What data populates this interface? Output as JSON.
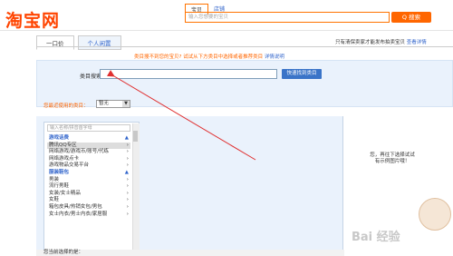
{
  "header": {
    "logo": "淘宝网",
    "search_tabs": [
      "宝贝",
      "店铺"
    ],
    "search_placeholder": "输入您想要的宝贝",
    "search_button": "Q 搜索"
  },
  "tabs": [
    "一口价",
    "个人闲置"
  ],
  "topright": {
    "text": "只有清保卖家才能发布拍卖宝贝",
    "link": "查看详情"
  },
  "notice": {
    "text": "类目搜不到您的宝贝? 试试从下方类目中选择或者推荐类目",
    "link": "详情说明"
  },
  "category_search": {
    "label": "类目搜索：",
    "button": "快速找到类目"
  },
  "recent": {
    "label": "您最近使用的类目：",
    "value": "暂无"
  },
  "category_list": {
    "filter_placeholder": "输入名称/拼音首字母",
    "items": [
      {
        "label": "游戏话费",
        "type": "group"
      },
      {
        "label": "腾讯QQ专区",
        "type": "selected"
      },
      {
        "label": "网络游戏/游戏币/账号/代练",
        "type": "item"
      },
      {
        "label": "网络游戏点卡",
        "type": "item"
      },
      {
        "label": "游戏物品交易平台",
        "type": "item"
      },
      {
        "label": "服装鞋包",
        "type": "group"
      },
      {
        "label": "男装",
        "type": "item"
      },
      {
        "label": "流行男鞋",
        "type": "item"
      },
      {
        "label": "女装/女士精品",
        "type": "item"
      },
      {
        "label": "女鞋",
        "type": "item"
      },
      {
        "label": "箱包皮具/热销女包/男包",
        "type": "item"
      },
      {
        "label": "女士内衣/男士内衣/家居服",
        "type": "item"
      }
    ]
  },
  "right_message": "您，再往下选择试试\n有示例图片哦！",
  "bottom_text": "您当前选择的是：",
  "watermark": "Bai 经验",
  "colors": {
    "accent": "#ff6600",
    "link": "#3366cc",
    "panel": "#eaf2fc",
    "arrow": "#e03030"
  }
}
